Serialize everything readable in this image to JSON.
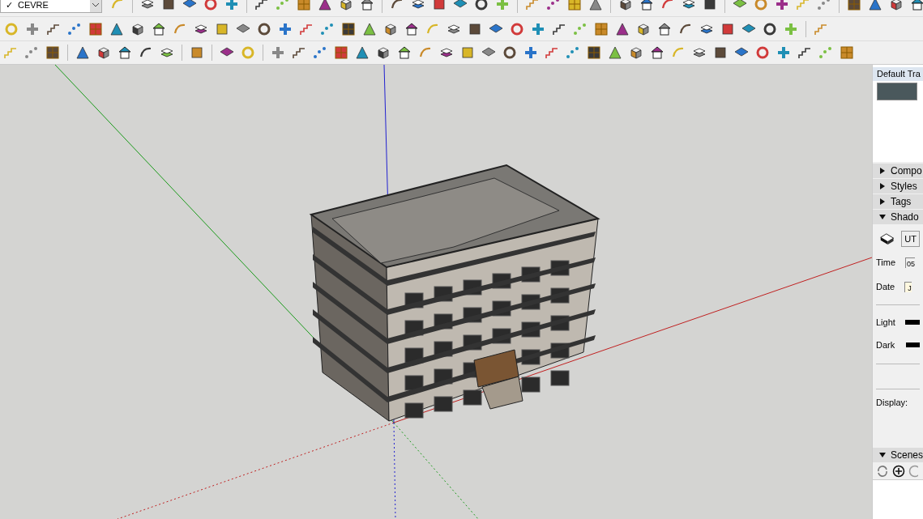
{
  "layer_dropdown": {
    "check": "✓",
    "value": "CEVRE"
  },
  "tray": {
    "title": "Default Tra",
    "sections": [
      {
        "label": "Compo",
        "expanded": false
      },
      {
        "label": "Styles",
        "expanded": false
      },
      {
        "label": "Tags",
        "expanded": false
      },
      {
        "label": "Shado",
        "expanded": true
      }
    ],
    "shadows": {
      "timezone": "UT",
      "time_label": "Time",
      "time_value": "05",
      "date_label": "Date",
      "date_value": "J",
      "light_label": "Light",
      "dark_label": "Dark",
      "display_label": "Display:"
    },
    "scenes": {
      "label": "Scenes",
      "expanded": true
    }
  }
}
